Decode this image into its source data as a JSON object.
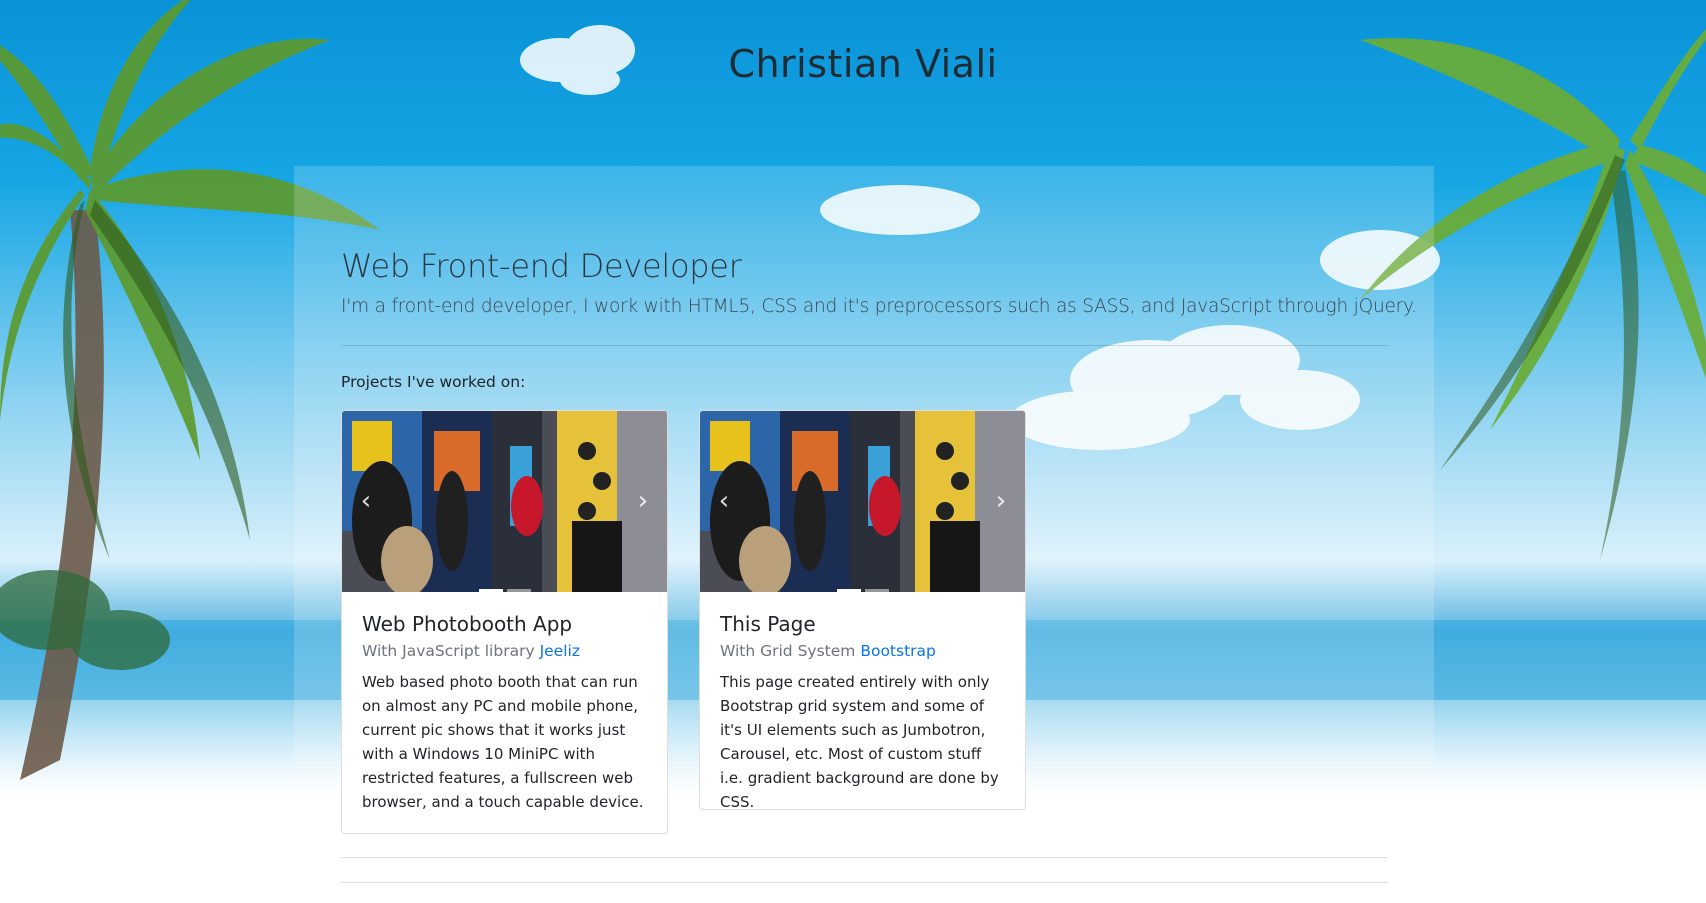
{
  "site": {
    "title": "Christian Viali"
  },
  "hero": {
    "heading": "Web Front-end Developer",
    "lead": "I'm a front-end developer, I work with HTML5, CSS and it's preprocessors such as SASS, and JavaScript through jQuery."
  },
  "projects": {
    "label": "Projects I've worked on:",
    "items": [
      {
        "title": "Web Photobooth App",
        "subtitle_prefix": "With JavaScript library",
        "link_label": "Jeeliz",
        "text": "Web based photo booth that can run on almost any PC and mobile phone, current pic shows that it works just with a Windows 10 MiniPC with restricted features, a fullscreen web browser, and a touch capable device.",
        "carousel_prev": "‹",
        "carousel_next": "›"
      },
      {
        "title": "This Page",
        "subtitle_prefix": "With Grid System",
        "link_label": "Bootstrap",
        "text": "This page created entirely with only Bootstrap grid system and some of it's UI elements such as Jumbotron, Carousel, etc. Most of custom stuff i.e. gradient background are done by CSS.",
        "carousel_prev": "‹",
        "carousel_next": "›"
      }
    ]
  },
  "colors": {
    "link": "#0a74e8",
    "sky": "#0fa0de",
    "muted": "#6c757d"
  }
}
